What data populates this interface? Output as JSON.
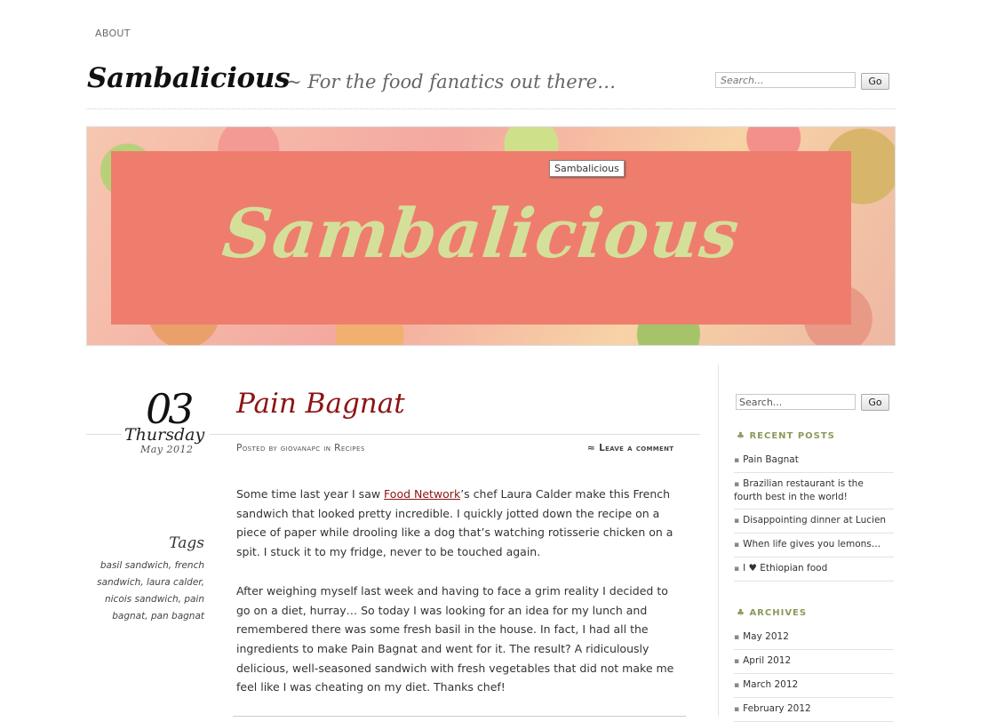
{
  "nav": {
    "about": "ABOUT"
  },
  "header": {
    "title": "Sambalicious",
    "description": "~ For the food fanatics out there…",
    "search_placeholder": "Search...",
    "go_label": "Go"
  },
  "banner": {
    "text": "Sambalicious",
    "tooltip": "Sambalicious"
  },
  "post": {
    "day_number": "03",
    "weekday": "Thursday",
    "month_year": "May 2012",
    "title": "Pain Bagnat",
    "posted_by_prefix": "Posted by",
    "author": "giovanapc",
    "in_word": "in",
    "category": "Recipes",
    "leave_comment_icon": "≈",
    "leave_comment": "Leave a comment",
    "p1_before": "Some time last year I saw ",
    "p1_link": "Food Network",
    "p1_after": "’s chef Laura Calder make this French sandwich that looked pretty incredible. I quickly jotted down the recipe on a piece of paper while drooling like a dog that’s watching rotisserie chicken on a spit. I stuck it to my fridge, never to be touched again.",
    "p2": "After weighing myself last week and having to face a grim reality I decided to go on a diet, hurray… So today I was looking for an idea for my lunch and remembered there was some fresh basil in the house. In fact, I had all the ingredients to make Pain Bagnat  and went for it. The result? A ridiculously delicious, well-seasoned sandwich with fresh vegetables that did not make me feel like I was cheating on my diet. Thanks chef!",
    "tags_title": "Tags",
    "tags": [
      "basil sandwich",
      "french sandwich",
      "laura calder",
      "nicois sandwich",
      "pain bagnat",
      "pan bagnat"
    ]
  },
  "sidebar": {
    "search_value": "Search...",
    "go_label": "Go",
    "recent_title": "♣ Recent Posts",
    "recent": [
      "Pain Bagnat",
      "Brazilian restaurant is the fourth best in the world!",
      "Disappointing dinner at Lucien",
      "When life gives you lemons…",
      "I ♥ Ethiopian food"
    ],
    "archives_title": "♣ Archives",
    "archives": [
      "May 2012",
      "April 2012",
      "March 2012",
      "February 2012"
    ]
  }
}
